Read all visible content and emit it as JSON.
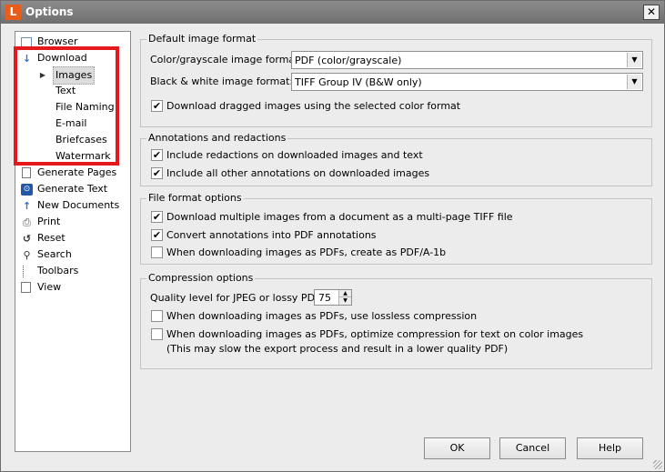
{
  "window": {
    "title": "Options",
    "app_icon_letter": "L",
    "close_symbol": "✕"
  },
  "sidebar": {
    "items": [
      {
        "label": "Browser",
        "icon": "browser-icon"
      },
      {
        "label": "Download",
        "icon": "download-arrow-icon"
      },
      {
        "label": "Images",
        "selected": true
      },
      {
        "label": "Text"
      },
      {
        "label": "File Naming"
      },
      {
        "label": "E-mail"
      },
      {
        "label": "Briefcases"
      },
      {
        "label": "Watermark"
      },
      {
        "label": "Generate Pages",
        "icon": "page-icon"
      },
      {
        "label": "Generate Text",
        "icon": "generate-text-icon"
      },
      {
        "label": "New Documents",
        "icon": "upload-arrow-icon"
      },
      {
        "label": "Print",
        "icon": "printer-icon"
      },
      {
        "label": "Reset",
        "icon": "reset-icon"
      },
      {
        "label": "Search",
        "icon": "magnifier-icon"
      },
      {
        "label": "Toolbars",
        "icon": "toolbar-icon"
      },
      {
        "label": "View",
        "icon": "view-icon"
      }
    ]
  },
  "default_image_format": {
    "title": "Default image format",
    "color_label": "Color/grayscale image format:",
    "color_value": "PDF (color/grayscale)",
    "bw_label": "Black & white image format:",
    "bw_value": "TIFF Group IV (B&W only)",
    "dragged_label": "Download dragged images using the selected color format",
    "dragged_checked": true
  },
  "annotations": {
    "title": "Annotations and redactions",
    "redactions_label": "Include redactions on downloaded images and text",
    "redactions_checked": true,
    "other_label": "Include all other annotations on downloaded images",
    "other_checked": true
  },
  "file_format": {
    "title": "File format options",
    "multipage_label": "Download multiple images from a document as a multi-page TIFF file",
    "multipage_checked": true,
    "convert_label": "Convert annotations into PDF annotations",
    "convert_checked": true,
    "pdfa_label": "When downloading images as PDFs, create as PDF/A-1b",
    "pdfa_checked": false
  },
  "compression": {
    "title": "Compression options",
    "quality_label": "Quality level for JPEG or lossy PDF:",
    "quality_value": "75",
    "lossless_label": "When downloading images as PDFs, use lossless compression",
    "lossless_checked": false,
    "optimize_label": "When downloading images as PDFs, optimize compression for text on color images",
    "optimize_note": "(This may slow the export process and result in a lower quality PDF)",
    "optimize_checked": false
  },
  "buttons": {
    "ok": "OK",
    "cancel": "Cancel",
    "help": "Help"
  },
  "symbols": {
    "check": "✔",
    "dropdown": "▼",
    "expand": "▶",
    "spin_up": "▲",
    "spin_down": "▼"
  },
  "colors": {
    "highlight_box": "#e3191c",
    "app_icon": "#e85d1b"
  }
}
